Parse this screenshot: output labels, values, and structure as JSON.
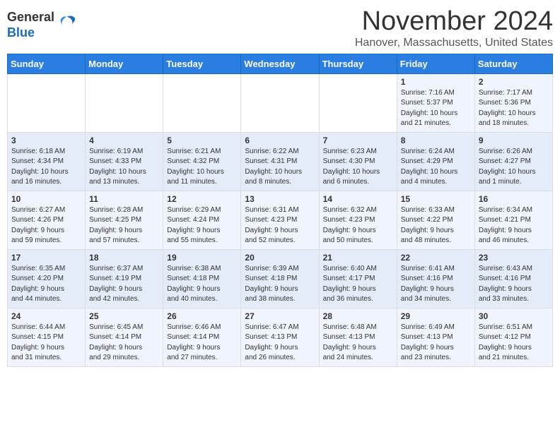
{
  "header": {
    "logo_general": "General",
    "logo_blue": "Blue",
    "month_title": "November 2024",
    "location": "Hanover, Massachusetts, United States"
  },
  "weekdays": [
    "Sunday",
    "Monday",
    "Tuesday",
    "Wednesday",
    "Thursday",
    "Friday",
    "Saturday"
  ],
  "weeks": [
    [
      {
        "day": "",
        "info": ""
      },
      {
        "day": "",
        "info": ""
      },
      {
        "day": "",
        "info": ""
      },
      {
        "day": "",
        "info": ""
      },
      {
        "day": "",
        "info": ""
      },
      {
        "day": "1",
        "info": "Sunrise: 7:16 AM\nSunset: 5:37 PM\nDaylight: 10 hours\nand 21 minutes."
      },
      {
        "day": "2",
        "info": "Sunrise: 7:17 AM\nSunset: 5:36 PM\nDaylight: 10 hours\nand 18 minutes."
      }
    ],
    [
      {
        "day": "3",
        "info": "Sunrise: 6:18 AM\nSunset: 4:34 PM\nDaylight: 10 hours\nand 16 minutes."
      },
      {
        "day": "4",
        "info": "Sunrise: 6:19 AM\nSunset: 4:33 PM\nDaylight: 10 hours\nand 13 minutes."
      },
      {
        "day": "5",
        "info": "Sunrise: 6:21 AM\nSunset: 4:32 PM\nDaylight: 10 hours\nand 11 minutes."
      },
      {
        "day": "6",
        "info": "Sunrise: 6:22 AM\nSunset: 4:31 PM\nDaylight: 10 hours\nand 8 minutes."
      },
      {
        "day": "7",
        "info": "Sunrise: 6:23 AM\nSunset: 4:30 PM\nDaylight: 10 hours\nand 6 minutes."
      },
      {
        "day": "8",
        "info": "Sunrise: 6:24 AM\nSunset: 4:29 PM\nDaylight: 10 hours\nand 4 minutes."
      },
      {
        "day": "9",
        "info": "Sunrise: 6:26 AM\nSunset: 4:27 PM\nDaylight: 10 hours\nand 1 minute."
      }
    ],
    [
      {
        "day": "10",
        "info": "Sunrise: 6:27 AM\nSunset: 4:26 PM\nDaylight: 9 hours\nand 59 minutes."
      },
      {
        "day": "11",
        "info": "Sunrise: 6:28 AM\nSunset: 4:25 PM\nDaylight: 9 hours\nand 57 minutes."
      },
      {
        "day": "12",
        "info": "Sunrise: 6:29 AM\nSunset: 4:24 PM\nDaylight: 9 hours\nand 55 minutes."
      },
      {
        "day": "13",
        "info": "Sunrise: 6:31 AM\nSunset: 4:23 PM\nDaylight: 9 hours\nand 52 minutes."
      },
      {
        "day": "14",
        "info": "Sunrise: 6:32 AM\nSunset: 4:23 PM\nDaylight: 9 hours\nand 50 minutes."
      },
      {
        "day": "15",
        "info": "Sunrise: 6:33 AM\nSunset: 4:22 PM\nDaylight: 9 hours\nand 48 minutes."
      },
      {
        "day": "16",
        "info": "Sunrise: 6:34 AM\nSunset: 4:21 PM\nDaylight: 9 hours\nand 46 minutes."
      }
    ],
    [
      {
        "day": "17",
        "info": "Sunrise: 6:35 AM\nSunset: 4:20 PM\nDaylight: 9 hours\nand 44 minutes."
      },
      {
        "day": "18",
        "info": "Sunrise: 6:37 AM\nSunset: 4:19 PM\nDaylight: 9 hours\nand 42 minutes."
      },
      {
        "day": "19",
        "info": "Sunrise: 6:38 AM\nSunset: 4:18 PM\nDaylight: 9 hours\nand 40 minutes."
      },
      {
        "day": "20",
        "info": "Sunrise: 6:39 AM\nSunset: 4:18 PM\nDaylight: 9 hours\nand 38 minutes."
      },
      {
        "day": "21",
        "info": "Sunrise: 6:40 AM\nSunset: 4:17 PM\nDaylight: 9 hours\nand 36 minutes."
      },
      {
        "day": "22",
        "info": "Sunrise: 6:41 AM\nSunset: 4:16 PM\nDaylight: 9 hours\nand 34 minutes."
      },
      {
        "day": "23",
        "info": "Sunrise: 6:43 AM\nSunset: 4:16 PM\nDaylight: 9 hours\nand 33 minutes."
      }
    ],
    [
      {
        "day": "24",
        "info": "Sunrise: 6:44 AM\nSunset: 4:15 PM\nDaylight: 9 hours\nand 31 minutes."
      },
      {
        "day": "25",
        "info": "Sunrise: 6:45 AM\nSunset: 4:14 PM\nDaylight: 9 hours\nand 29 minutes."
      },
      {
        "day": "26",
        "info": "Sunrise: 6:46 AM\nSunset: 4:14 PM\nDaylight: 9 hours\nand 27 minutes."
      },
      {
        "day": "27",
        "info": "Sunrise: 6:47 AM\nSunset: 4:13 PM\nDaylight: 9 hours\nand 26 minutes."
      },
      {
        "day": "28",
        "info": "Sunrise: 6:48 AM\nSunset: 4:13 PM\nDaylight: 9 hours\nand 24 minutes."
      },
      {
        "day": "29",
        "info": "Sunrise: 6:49 AM\nSunset: 4:13 PM\nDaylight: 9 hours\nand 23 minutes."
      },
      {
        "day": "30",
        "info": "Sunrise: 6:51 AM\nSunset: 4:12 PM\nDaylight: 9 hours\nand 21 minutes."
      }
    ]
  ]
}
